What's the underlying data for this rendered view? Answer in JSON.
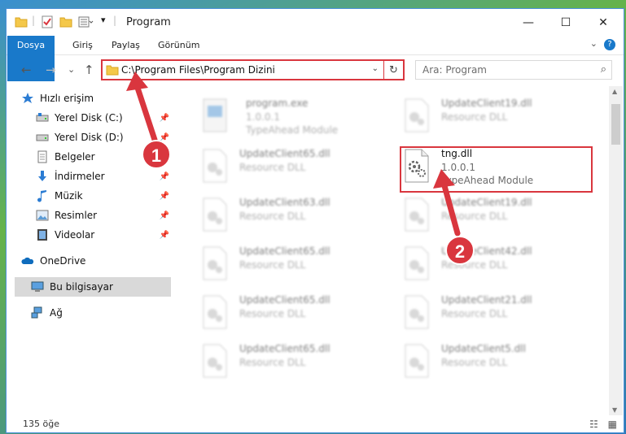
{
  "titlebar": {
    "title": "Program",
    "qat_sep": "|",
    "dropdown": "▾",
    "minimize": "—",
    "maximize": "☐",
    "close": "✕"
  },
  "ribbon": {
    "tabs": [
      "Dosya",
      "Giriş",
      "Paylaş",
      "Görünüm"
    ],
    "help": "?",
    "collapse": "⌄"
  },
  "nav": {
    "back": "←",
    "forward": "→",
    "recent": "⌄",
    "up": "↑",
    "address": "C:\\Program Files\\Program Dizini",
    "address_dropdown": "⌄",
    "refresh": "↻",
    "search_placeholder": "Ara: Program",
    "search_icon": "⌕"
  },
  "sidebar": {
    "items": [
      {
        "label": "Hızlı erişim",
        "icon": "star-icon"
      },
      {
        "label": "Yerel Disk (C:)",
        "icon": "drive-icon",
        "pinned": true
      },
      {
        "label": "Yerel Disk (D:)",
        "icon": "drive-icon",
        "pinned": true
      },
      {
        "label": "Belgeler",
        "icon": "documents-icon",
        "pinned": true
      },
      {
        "label": "İndirmeler",
        "icon": "downloads-icon",
        "pinned": true
      },
      {
        "label": "Müzik",
        "icon": "music-icon",
        "pinned": true
      },
      {
        "label": "Resimler",
        "icon": "pictures-icon",
        "pinned": true
      },
      {
        "label": "Videolar",
        "icon": "videos-icon",
        "pinned": true
      },
      {
        "label": "OneDrive",
        "icon": "onedrive-icon"
      },
      {
        "label": "Bu bilgisayar",
        "icon": "computer-icon",
        "selected": true
      },
      {
        "label": "Ağ",
        "icon": "network-icon"
      }
    ],
    "pin_glyph": "📌"
  },
  "files": [
    {
      "name": "program.exe",
      "version": "1.0.0.1",
      "desc": "TypeAhead Module",
      "icon": "exe-icon"
    },
    {
      "name": "UpdateClient19.dll",
      "version": "Resource DLL",
      "desc": "",
      "icon": "dll-icon"
    },
    {
      "name": "UpdateClient65.dll",
      "version": "Resource DLL",
      "desc": "",
      "icon": "dll-icon"
    },
    {
      "name": "tng.dll",
      "version": "1.0.0.1",
      "desc": "TypeAhead Module",
      "icon": "dll-icon",
      "highlighted": true
    },
    {
      "name": "UpdateClient63.dll",
      "version": "Resource DLL",
      "desc": "",
      "icon": "dll-icon"
    },
    {
      "name": "UpdateClient19.dll",
      "version": "Resource DLL",
      "desc": "",
      "icon": "dll-icon"
    },
    {
      "name": "UpdateClient65.dll",
      "version": "Resource DLL",
      "desc": "",
      "icon": "dll-icon"
    },
    {
      "name": "UpdateClient42.dll",
      "version": "Resource DLL",
      "desc": "",
      "icon": "dll-icon"
    },
    {
      "name": "UpdateClient65.dll",
      "version": "Resource DLL",
      "desc": "",
      "icon": "dll-icon"
    },
    {
      "name": "UpdateClient21.dll",
      "version": "Resource DLL",
      "desc": "",
      "icon": "dll-icon"
    },
    {
      "name": "UpdateClient65.dll",
      "version": "Resource DLL",
      "desc": "",
      "icon": "dll-icon"
    },
    {
      "name": "UpdateClient5.dll",
      "version": "Resource DLL",
      "desc": "",
      "icon": "dll-icon"
    }
  ],
  "status": {
    "count": "135 öğe",
    "view_details": "☷",
    "view_tiles": "▦"
  },
  "annotations": {
    "step1": "1",
    "step2": "2",
    "color": "#d9363e"
  },
  "colors": {
    "accent": "#1979ca",
    "highlight_border": "#d9363e"
  }
}
